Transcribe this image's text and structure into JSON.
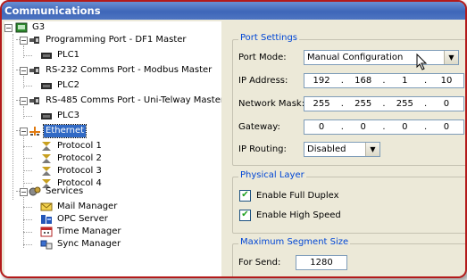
{
  "window": {
    "title": "Communications"
  },
  "tree": [
    {
      "label": "G3",
      "icon": "device-icon"
    },
    {
      "label": "Programming Port - DF1 Master",
      "icon": "port-icon"
    },
    {
      "label": "PLC1",
      "icon": "plc-icon"
    },
    {
      "label": "RS-232 Comms Port - Modbus Master",
      "icon": "port-icon"
    },
    {
      "label": "PLC2",
      "icon": "plc-icon"
    },
    {
      "label": "RS-485 Comms Port - Uni-Telway Master",
      "icon": "port-icon"
    },
    {
      "label": "PLC3",
      "icon": "plc-icon"
    },
    {
      "label": "Ethernet",
      "icon": "ethernet-icon"
    },
    {
      "label": "Protocol 1",
      "icon": "protocol-icon"
    },
    {
      "label": "Protocol 2",
      "icon": "protocol-icon"
    },
    {
      "label": "Protocol 3",
      "icon": "protocol-icon"
    },
    {
      "label": "Protocol 4",
      "icon": "protocol-icon"
    },
    {
      "label": "Services",
      "icon": "services-icon"
    },
    {
      "label": "Mail Manager",
      "icon": "mail-icon"
    },
    {
      "label": "OPC Server",
      "icon": "opc-icon"
    },
    {
      "label": "Time Manager",
      "icon": "time-icon"
    },
    {
      "label": "Sync Manager",
      "icon": "sync-icon"
    }
  ],
  "port_settings": {
    "group_title": "Port Settings",
    "port_mode_label": "Port Mode:",
    "port_mode_value": "Manual Configuration",
    "ip_label": "IP Address:",
    "ip": [
      "192",
      "168",
      "1",
      "10"
    ],
    "mask_label": "Network Mask:",
    "mask": [
      "255",
      "255",
      "255",
      "0"
    ],
    "gateway_label": "Gateway:",
    "gateway": [
      "0",
      "0",
      "0",
      "0"
    ],
    "routing_label": "IP Routing:",
    "routing_value": "Disabled"
  },
  "physical_layer": {
    "group_title": "Physical Layer",
    "full_duplex_label": "Enable Full Duplex",
    "full_duplex_checked": true,
    "high_speed_label": "Enable High Speed",
    "high_speed_checked": true
  },
  "segment": {
    "group_title": "Maximum Segment Size",
    "send_label": "For Send:",
    "send_value": "1280"
  },
  "colors": {
    "border": "#b31a1a",
    "title_bar": "#3e66b8",
    "selection": "#316ac5",
    "group_title": "#0046d5"
  }
}
